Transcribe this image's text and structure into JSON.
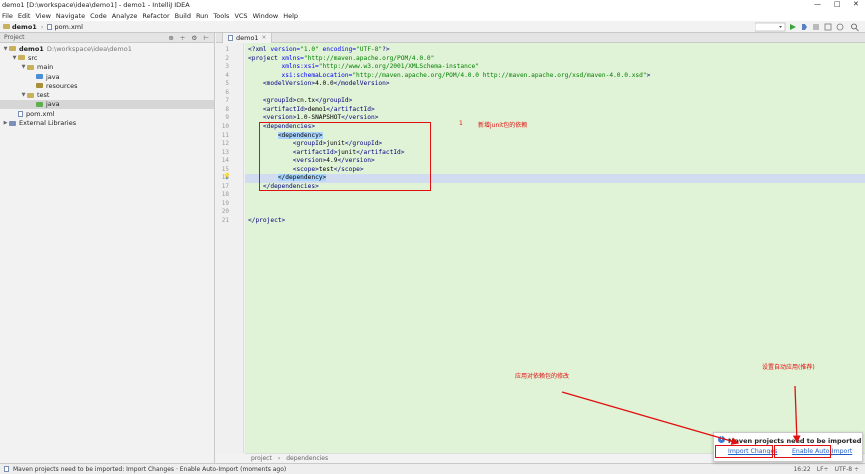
{
  "window": {
    "title": "demo1 [D:\\workspace\\idea\\demo1] - demo1 - IntelliJ IDEA",
    "controls": [
      "—",
      "□",
      "✕"
    ]
  },
  "menu": [
    "File",
    "Edit",
    "View",
    "Navigate",
    "Code",
    "Analyze",
    "Refactor",
    "Build",
    "Run",
    "Tools",
    "VCS",
    "Window",
    "Help"
  ],
  "navbar": {
    "project": "demo1",
    "file": "pom.xml"
  },
  "project_panel": {
    "title": "Project",
    "tree": [
      {
        "label": "demo1",
        "extra": "D:\\workspace\\idea\\demo1",
        "arrow": "▼",
        "depth": 0,
        "type": "module"
      },
      {
        "label": "src",
        "arrow": "▼",
        "depth": 1,
        "type": "folder"
      },
      {
        "label": "main",
        "arrow": "▼",
        "depth": 2,
        "type": "folder"
      },
      {
        "label": "java",
        "arrow": "",
        "depth": 3,
        "type": "src"
      },
      {
        "label": "resources",
        "arrow": "",
        "depth": 3,
        "type": "res"
      },
      {
        "label": "test",
        "arrow": "▼",
        "depth": 2,
        "type": "folder"
      },
      {
        "label": "java",
        "arrow": "",
        "depth": 3,
        "type": "test",
        "selected": true
      },
      {
        "label": "pom.xml",
        "arrow": "",
        "depth": 1,
        "type": "file"
      },
      {
        "label": "External Libraries",
        "arrow": "▶",
        "depth": 0,
        "type": "lib"
      }
    ]
  },
  "editor": {
    "tab": "demo1",
    "lines": [
      "1",
      "2",
      "3",
      "4",
      "5",
      "6",
      "7",
      "8",
      "9",
      "10",
      "11",
      "12",
      "13",
      "14",
      "15",
      "16",
      "17",
      "18",
      "19",
      "20",
      "21"
    ],
    "code": [
      [
        [
          "tag",
          "<?"
        ],
        [
          "tagname",
          "xml "
        ],
        [
          "attr",
          "version="
        ],
        [
          "val",
          "\"1.0\" "
        ],
        [
          "attr",
          "encoding="
        ],
        [
          "val",
          "\"UTF-8\""
        ],
        [
          "tag",
          "?>"
        ]
      ],
      [
        [
          "tag",
          "<"
        ],
        [
          "tagname",
          "project "
        ],
        [
          "attr",
          "xmlns="
        ],
        [
          "val",
          "\"http://maven.apache.org/POM/4.0.0\""
        ]
      ],
      [
        [
          "txt",
          "         "
        ],
        [
          "attr",
          "xmlns:xsi="
        ],
        [
          "val",
          "\"http://www.w3.org/2001/XMLSchema-instance\""
        ]
      ],
      [
        [
          "txt",
          "         "
        ],
        [
          "attr",
          "xsi:schemaLocation="
        ],
        [
          "val",
          "\"http://maven.apache.org/POM/4.0.0 http://maven.apache.org/xsd/maven-4.0.0.xsd\""
        ],
        [
          "tag",
          ">"
        ]
      ],
      [
        [
          "txt",
          "    "
        ],
        [
          "tag",
          "<"
        ],
        [
          "tagname",
          "modelVersion"
        ],
        [
          "tag",
          ">"
        ],
        [
          "txt",
          "4.0.0"
        ],
        [
          "tag",
          "</"
        ],
        [
          "tagname",
          "modelVersion"
        ],
        [
          "tag",
          ">"
        ]
      ],
      [],
      [
        [
          "txt",
          "    "
        ],
        [
          "tag",
          "<"
        ],
        [
          "tagname",
          "groupId"
        ],
        [
          "tag",
          ">"
        ],
        [
          "txt",
          "cn.tx"
        ],
        [
          "tag",
          "</"
        ],
        [
          "tagname",
          "groupId"
        ],
        [
          "tag",
          ">"
        ]
      ],
      [
        [
          "txt",
          "    "
        ],
        [
          "tag",
          "<"
        ],
        [
          "tagname",
          "artifactId"
        ],
        [
          "tag",
          ">"
        ],
        [
          "txt",
          "demo1"
        ],
        [
          "tag",
          "</"
        ],
        [
          "tagname",
          "artifactId"
        ],
        [
          "tag",
          ">"
        ]
      ],
      [
        [
          "txt",
          "    "
        ],
        [
          "tag",
          "<"
        ],
        [
          "tagname",
          "version"
        ],
        [
          "tag",
          ">"
        ],
        [
          "txt",
          "1.0-SNAPSHOT"
        ],
        [
          "tag",
          "</"
        ],
        [
          "tagname",
          "version"
        ],
        [
          "tag",
          ">"
        ]
      ],
      [
        [
          "txt",
          "    "
        ],
        [
          "tag",
          "<"
        ],
        [
          "tagname",
          "dependencies"
        ],
        [
          "tag",
          ">"
        ]
      ],
      [
        [
          "txt",
          "        "
        ],
        [
          "hl",
          "<dependency>"
        ]
      ],
      [
        [
          "txt",
          "            "
        ],
        [
          "tag",
          "<"
        ],
        [
          "tagname",
          "groupId"
        ],
        [
          "tag",
          ">"
        ],
        [
          "txt",
          "junit"
        ],
        [
          "tag",
          "</"
        ],
        [
          "tagname",
          "groupId"
        ],
        [
          "tag",
          ">"
        ]
      ],
      [
        [
          "txt",
          "            "
        ],
        [
          "tag",
          "<"
        ],
        [
          "tagname",
          "artifactId"
        ],
        [
          "tag",
          ">"
        ],
        [
          "txt",
          "junit"
        ],
        [
          "tag",
          "</"
        ],
        [
          "tagname",
          "artifactId"
        ],
        [
          "tag",
          ">"
        ]
      ],
      [
        [
          "txt",
          "            "
        ],
        [
          "tag",
          "<"
        ],
        [
          "tagname",
          "version"
        ],
        [
          "tag",
          ">"
        ],
        [
          "txt",
          "4.9"
        ],
        [
          "tag",
          "</"
        ],
        [
          "tagname",
          "version"
        ],
        [
          "tag",
          ">"
        ]
      ],
      [
        [
          "txt",
          "            "
        ],
        [
          "tag",
          "<"
        ],
        [
          "tagname",
          "scope"
        ],
        [
          "tag",
          ">"
        ],
        [
          "txt",
          "test"
        ],
        [
          "tag",
          "</"
        ],
        [
          "tagname",
          "scope"
        ],
        [
          "tag",
          ">"
        ]
      ],
      [
        [
          "txt",
          "        "
        ],
        [
          "hl",
          "</dependency>"
        ]
      ],
      [
        [
          "txt",
          "    "
        ],
        [
          "tag",
          "</"
        ],
        [
          "tagname",
          "dependencies"
        ],
        [
          "tag",
          ">"
        ]
      ],
      [],
      [],
      [],
      [
        [
          "tag",
          "</"
        ],
        [
          "tagname",
          "project"
        ],
        [
          "tag",
          ">"
        ]
      ]
    ],
    "breadcrumbs": [
      "project",
      "dependencies"
    ]
  },
  "annotations": {
    "step_number": "1",
    "add_dependency": "新增junit包的依赖",
    "apply_changes": "应用对依赖包的修改",
    "auto_import": "设置自动应用(推荐)"
  },
  "notification": {
    "title": "Maven projects need to be imported",
    "import_changes": "Import Changes",
    "enable_auto_import": "Enable Auto-Import"
  },
  "status": {
    "message": "Maven projects need to be imported: Import Changes · Enable Auto-Import (moments ago)",
    "position": "16:22",
    "line_sep": "LF÷",
    "encoding": "UTF-8 ÷"
  },
  "colors": {
    "annotation_red": "#e01010",
    "editor_bg": "#e1f3d6",
    "link_blue": "#2060c8"
  }
}
